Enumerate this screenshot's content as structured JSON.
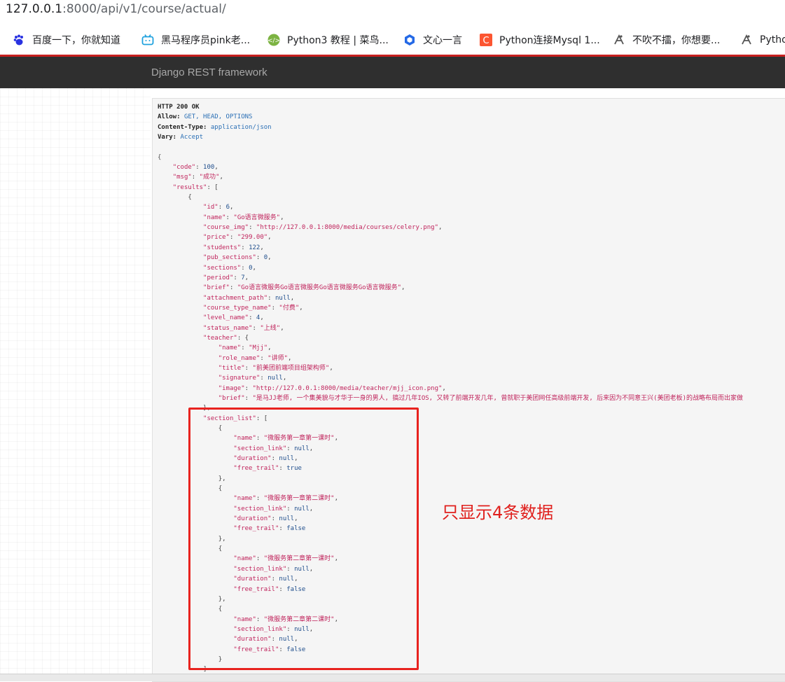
{
  "browser": {
    "url_host": "127.0.0.1",
    "url_rest": ":8000/api/v1/course/actual/",
    "bookmarks": [
      {
        "label": "百度一下，你就知道",
        "icon": "paw-icon"
      },
      {
        "label": "黑马程序员pink老...",
        "icon": "bilibili-tv-icon"
      },
      {
        "label": "Python3 教程 | 菜鸟...",
        "icon": "runoob-icon"
      },
      {
        "label": "文心一言",
        "icon": "wenxin-icon"
      },
      {
        "label": "Python连接Mysql 1...",
        "icon": "csdn-c-icon"
      },
      {
        "label": "不吹不擂，你想要...",
        "icon": "zhihu-person-icon"
      },
      {
        "label": "Pytho",
        "icon": "zhihu-person-icon"
      }
    ]
  },
  "navbar": {
    "brand": "Django REST framework"
  },
  "response": {
    "status": "HTTP 200 OK",
    "headers": [
      {
        "key": "Allow:",
        "value": "GET, HEAD, OPTIONS"
      },
      {
        "key": "Content-Type:",
        "value": "application/json"
      },
      {
        "key": "Vary:",
        "value": "Accept"
      }
    ],
    "body": {
      "code": 100,
      "msg": "成功",
      "result": {
        "id": 6,
        "name": "Go语言微服务",
        "course_img": "http://127.0.0.1:8000/media/courses/celery.png",
        "price": "299.00",
        "students": 122,
        "pub_sections": 0,
        "sections": 0,
        "period": 7,
        "brief": "Go语言微服务Go语言微服务Go语言微服务Go语言微服务",
        "attachment_path": "null",
        "course_type_name": "付费",
        "level_name": 4,
        "status_name": "上线",
        "teacher": {
          "name": "Mjj",
          "role_name": "讲师",
          "title": "前美团前端项目组架构师",
          "signature": "null",
          "image": "http://127.0.0.1:8000/media/teacher/mjj_icon.png",
          "brief": "是马JJ老师, 一个集美貌与才华于一身的男人, 搞过几年IOS, 又转了前端开发几年, 曾就职于美团网任高级前端开发, 后来因为不同意王兴(美团老板)的战略布局而出家做"
        },
        "section_list": [
          {
            "name": "微服务第一章第一课时",
            "section_link": "null",
            "duration": "null",
            "free_trail": "true"
          },
          {
            "name": "微服务第一章第二课时",
            "section_link": "null",
            "duration": "null",
            "free_trail": "false"
          },
          {
            "name": "微服务第二章第一课时",
            "section_link": "null",
            "duration": "null",
            "free_trail": "false"
          },
          {
            "name": "微服务第二章第二课时",
            "section_link": "null",
            "duration": "null",
            "free_trail": "false"
          }
        ]
      }
    }
  },
  "annotation": {
    "text": "只显示4条数据",
    "color": "#e0201d"
  },
  "colors": {
    "navbar": "#2f2f2f",
    "navbar_accent": "#c7201f",
    "json_key": "#c0245c",
    "json_literal": "#1f4e8c"
  }
}
